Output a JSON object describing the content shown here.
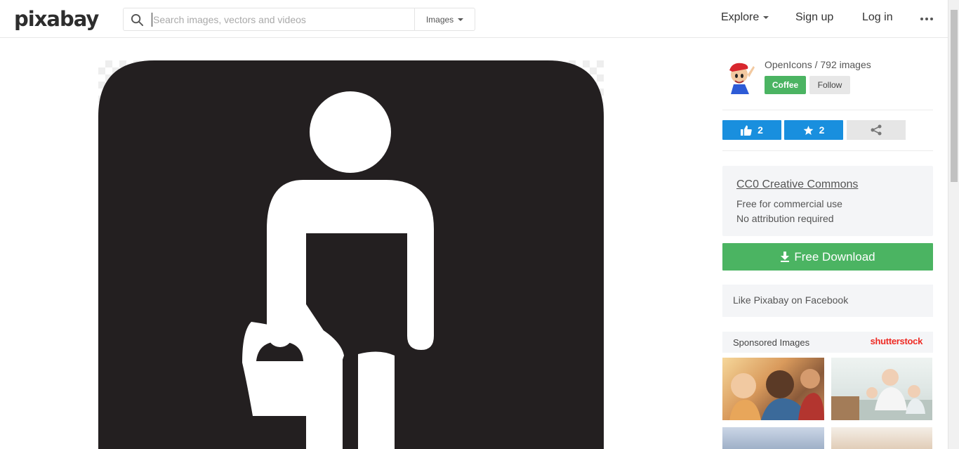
{
  "header": {
    "logo": "pixabay",
    "search": {
      "placeholder": "Search images, vectors and videos",
      "value": "",
      "type_label": "Images"
    },
    "nav": {
      "explore": "Explore",
      "signup": "Sign up",
      "login": "Log in"
    }
  },
  "author": {
    "name_line": "OpenIcons / 792 images",
    "coffee_label": "Coffee",
    "follow_label": "Follow"
  },
  "stats": {
    "likes": "2",
    "favorites": "2"
  },
  "license": {
    "title": "CC0 Creative Commons",
    "line1": "Free for commercial use",
    "line2": "No attribution required"
  },
  "download": {
    "label": "Free Download"
  },
  "facebook": {
    "label": "Like Pixabay on Facebook"
  },
  "sponsored": {
    "label": "Sponsored Images",
    "brand": "shutterstock"
  },
  "icons": [
    "search-icon",
    "chevron-down-icon",
    "more-icon",
    "thumbs-up-icon",
    "star-icon",
    "share-icon",
    "download-icon"
  ],
  "colors": {
    "green": "#4bb462",
    "blue": "#198fde",
    "icon_bg": "#231f20",
    "panel_bg": "#f4f5f7"
  }
}
